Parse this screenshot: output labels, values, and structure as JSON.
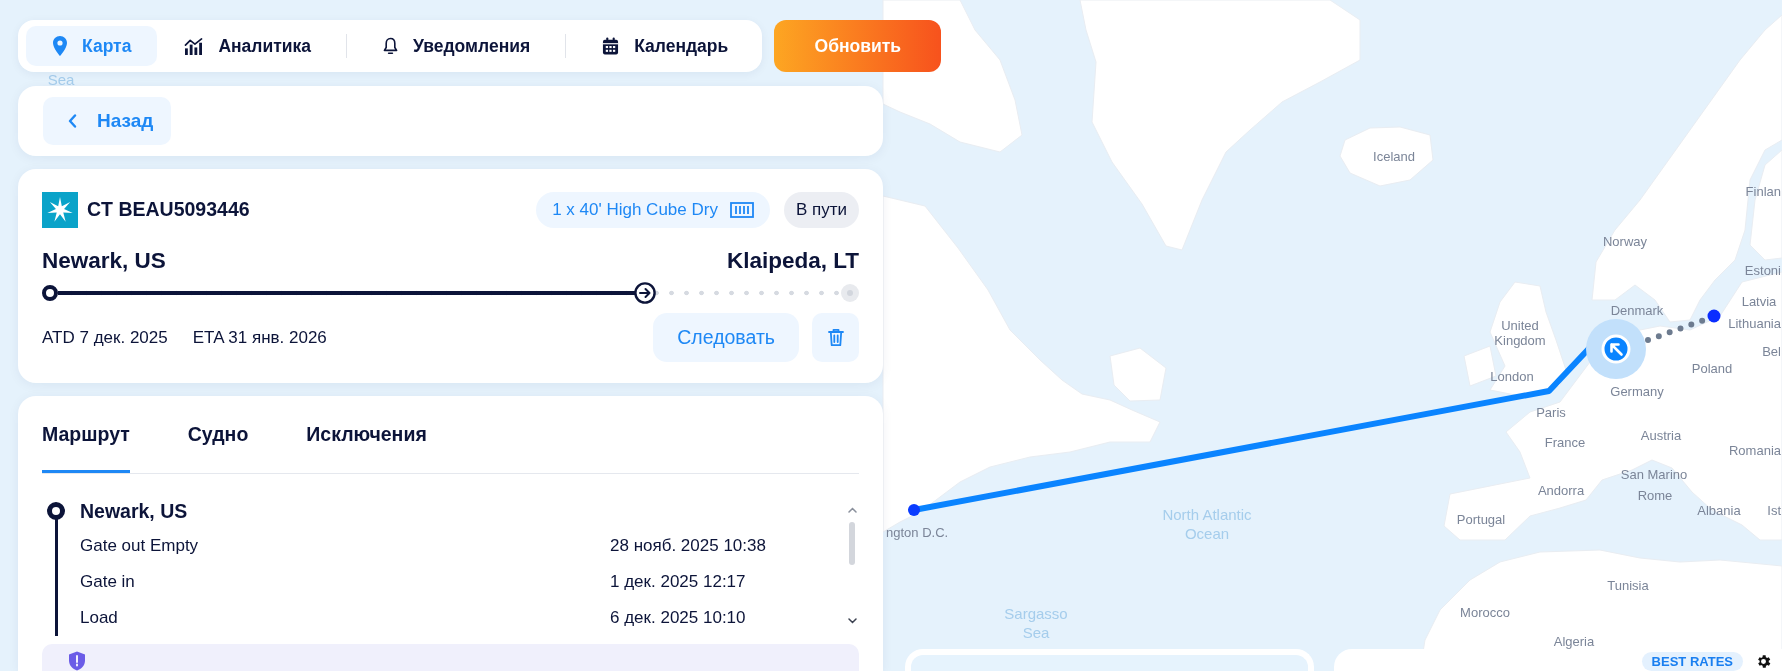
{
  "nav": {
    "tabs": [
      {
        "label": "Карта",
        "selected": true
      },
      {
        "label": "Аналитика",
        "selected": false
      },
      {
        "label": "Уведомления",
        "selected": false
      },
      {
        "label": "Календарь",
        "selected": false
      }
    ],
    "refresh_button": "Обновить"
  },
  "back_button": "Назад",
  "shipment": {
    "container_number": "CT BEAU5093446",
    "container_type": "1 x 40' High Cube Dry",
    "status": "В пути",
    "origin": "Newark, US",
    "destination": "Klaipeda, LT",
    "progress": {
      "level": 0.75
    },
    "departure": "ATD 7 дек. 2025",
    "arrival": "ETA 31 янв. 2026",
    "follow_button": "Следовать"
  },
  "details": {
    "tabs": [
      {
        "label": "Маршрут",
        "selected": true
      },
      {
        "label": "Судно",
        "selected": false
      },
      {
        "label": "Исключения",
        "selected": false
      }
    ],
    "stops": [
      {
        "name": "Newark, US",
        "events": [
          {
            "name": "Gate out Empty",
            "time": "28 нояб. 2025 10:38"
          },
          {
            "name": "Gate in",
            "time": "1 дек. 2025 12:17"
          },
          {
            "name": "Load",
            "time": "6 дек. 2025 10:10"
          }
        ]
      }
    ]
  },
  "map": {
    "labels": [
      {
        "text": "Sea",
        "kind": "water"
      },
      {
        "text": "Iceland",
        "kind": "place"
      },
      {
        "text": "Finlan",
        "kind": "place"
      },
      {
        "text": "Norway",
        "kind": "place"
      },
      {
        "text": "Estoni",
        "kind": "place"
      },
      {
        "text": "Denmark",
        "kind": "place"
      },
      {
        "text": "Latvia",
        "kind": "place"
      },
      {
        "text": "United Kingdom",
        "kind": "place"
      },
      {
        "text": "Lithuania",
        "kind": "place"
      },
      {
        "text": "Bel",
        "kind": "place"
      },
      {
        "text": "London",
        "kind": "place"
      },
      {
        "text": "Poland",
        "kind": "place"
      },
      {
        "text": "Germany",
        "kind": "place"
      },
      {
        "text": "Paris",
        "kind": "place"
      },
      {
        "text": "France",
        "kind": "place"
      },
      {
        "text": "Austria",
        "kind": "place"
      },
      {
        "text": "Romania",
        "kind": "place"
      },
      {
        "text": "San Marino",
        "kind": "place"
      },
      {
        "text": "Andorra",
        "kind": "place"
      },
      {
        "text": "Rome",
        "kind": "place"
      },
      {
        "text": "ngton D.C.",
        "kind": "place"
      },
      {
        "text": "North Atlantic Ocean",
        "kind": "water"
      },
      {
        "text": "Portugal",
        "kind": "place"
      },
      {
        "text": "Albania",
        "kind": "place"
      },
      {
        "text": "Ist",
        "kind": "place"
      },
      {
        "text": "Tunisia",
        "kind": "place"
      },
      {
        "text": "Sargasso Sea",
        "kind": "water"
      },
      {
        "text": "Morocco",
        "kind": "place"
      },
      {
        "text": "Algeria",
        "kind": "place"
      }
    ],
    "best_rates_button": "BEST RATES"
  }
}
